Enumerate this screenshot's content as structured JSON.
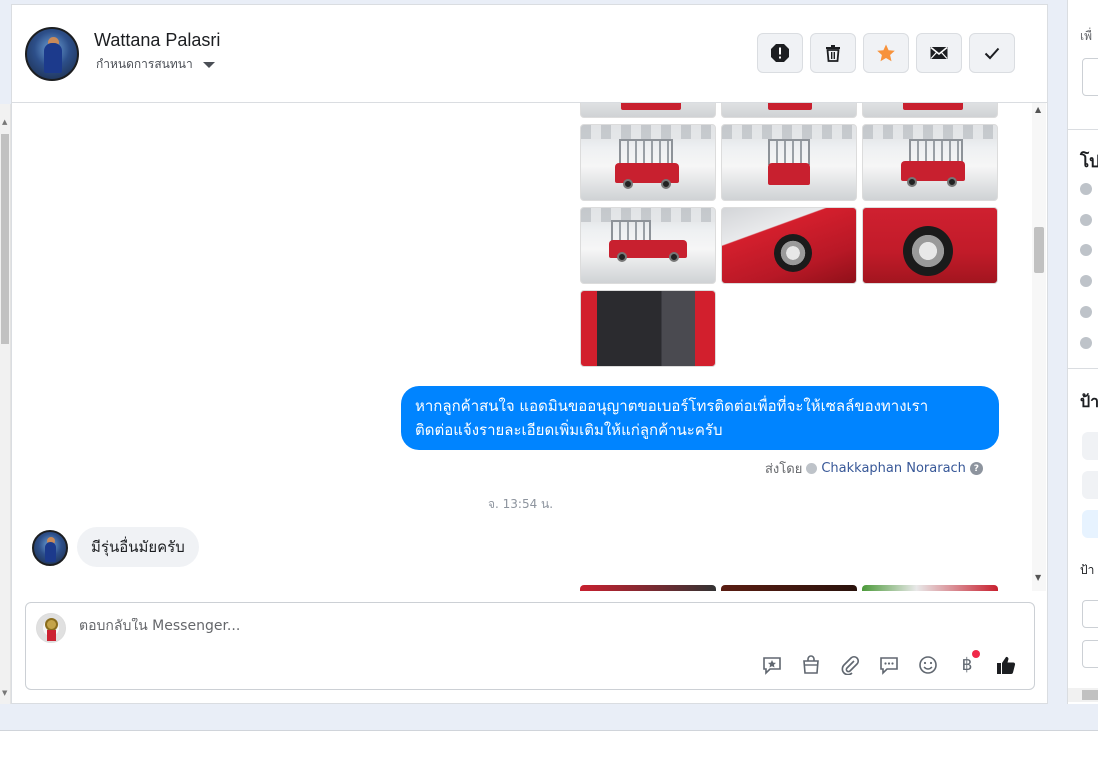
{
  "header": {
    "user_name": "Wattana Palasri",
    "conversation_setting": "กำหนดการสนทนา",
    "actions": [
      {
        "name": "report-button",
        "icon": "alert-octagon-icon"
      },
      {
        "name": "delete-button",
        "icon": "trash-icon"
      },
      {
        "name": "star-button",
        "icon": "star-icon",
        "color": "#f7923b"
      },
      {
        "name": "mail-button",
        "icon": "envelope-icon"
      },
      {
        "name": "done-button",
        "icon": "checkmark-icon"
      }
    ]
  },
  "messages": {
    "outgoing_text_line1": "หากลูกค้าสนใจ แอดมินขออนุญาตขอเบอร์โทรติดต่อเพื่อที่จะให้เซลล์ของทางเรา",
    "outgoing_text_line2": "ติดต่อแจ้งรายละเอียดเพิ่มเติมให้แก่ลูกค้านะครับ",
    "sent_by_label": "ส่งโดย",
    "sent_by_agent": "Chakkaphan Norarach",
    "timestamp": "จ. 13:54 น.",
    "incoming_text": "มีรุ่นอื่นมัยครับ",
    "accent_color": "#0084ff"
  },
  "reply": {
    "placeholder": "ตอบกลับใน Messenger...",
    "tools": [
      "saved-reply-icon",
      "shop-bag-icon",
      "attachment-icon",
      "chat-bubble-icon",
      "emoji-icon",
      "baht-icon",
      "thumbs-up-icon"
    ],
    "baht_symbol": "฿"
  },
  "right_panel": {
    "partial_text_1": "เพื่",
    "partial_heading": "โป",
    "partial_heading_2": "ป้า",
    "partial_text_2": "ป้า"
  }
}
